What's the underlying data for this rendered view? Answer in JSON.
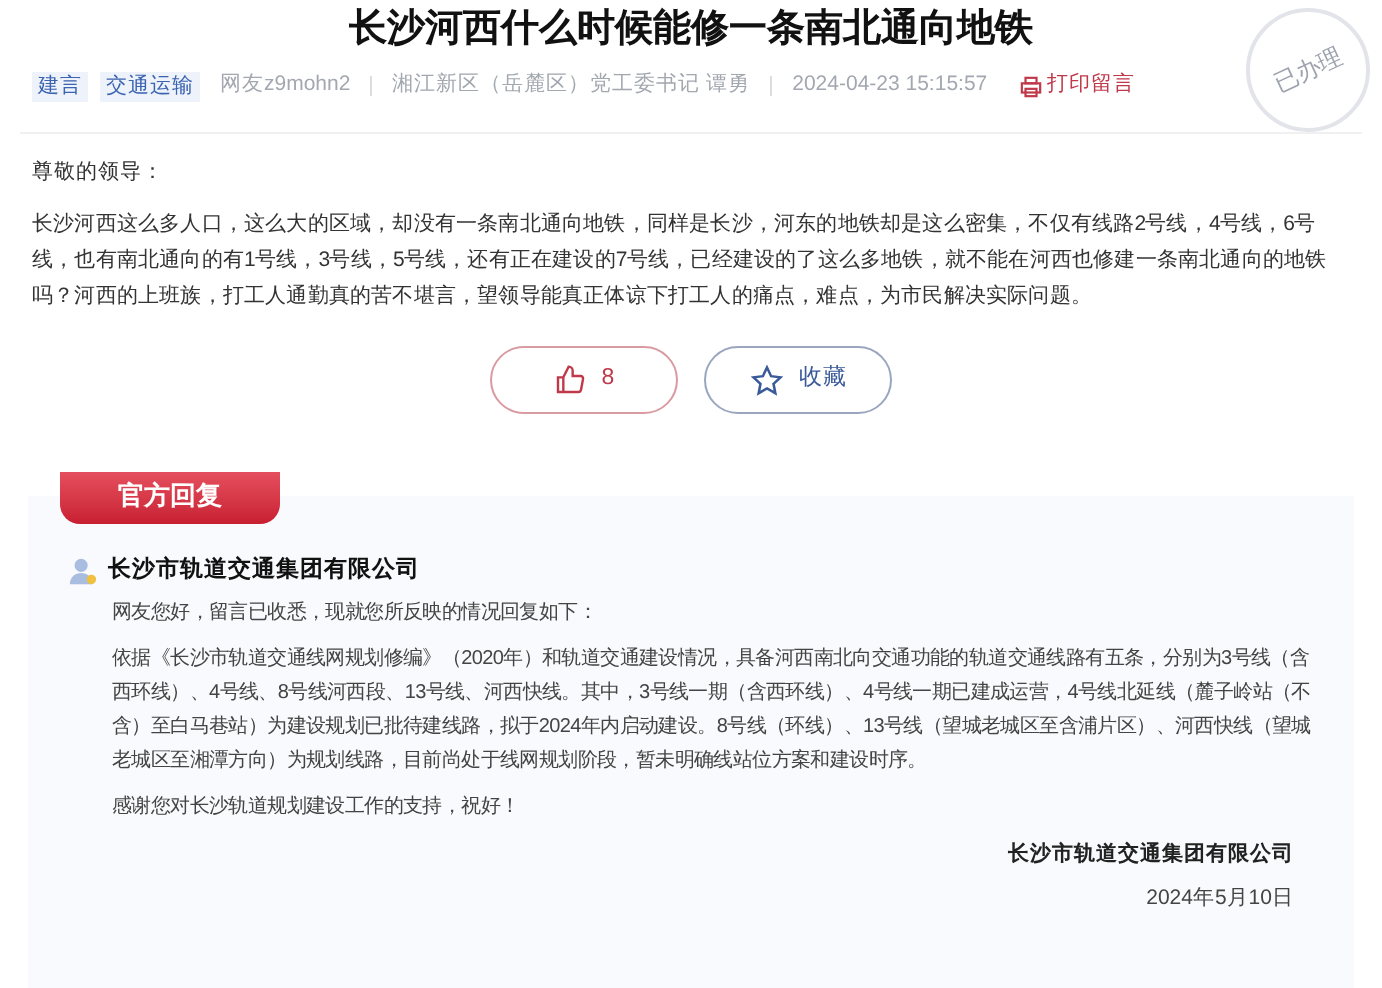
{
  "title": "长沙河西什么时候能修一条南北通向地铁",
  "tags": [
    "建言",
    "交通运输"
  ],
  "meta": [
    "网友z9mohn2",
    "湘江新区（岳麓区）党工委书记 谭勇",
    "2024-04-23 15:15:57"
  ],
  "print_link": "打印留言",
  "stamp": "已办理",
  "message": {
    "greeting": "尊敬的领导：",
    "body": "长沙河西这么多人口，这么大的区域，却没有一条南北通向地铁，同样是长沙，河东的地铁却是这么密集，不仅有线路2号线，4号线，6号线，也有南北通向的有1号线，3号线，5号线，还有正在建设的7号线，已经建设的了这么多地铁，就不能在河西也修建一条南北通向的地铁吗？河西的上班族，打工人通勤真的苦不堪言，望领导能真正体谅下打工人的痛点，难点，为市民解决实际问题。"
  },
  "actions": [
    {
      "kind": "like",
      "text": "8"
    },
    {
      "kind": "favorite",
      "text": "收藏"
    }
  ],
  "reply": {
    "ribbon": "官方回复",
    "org": "长沙市轨道交通集团有限公司",
    "paragraphs": [
      "网友您好，留言已收悉，现就您所反映的情况回复如下：",
      "依据《长沙市轨道交通线网规划修编》（2020年）和轨道交通建设情况，具备河西南北向交通功能的轨道交通线路有五条，分别为3号线（含西环线）、4号线、8号线河西段、13号线、河西快线。其中，3号线一期（含西环线）、4号线一期已建成运营，4号线北延线（麓子岭站（不含）至白马巷站）为建设规划已批待建线路，拟于2024年内启动建设。8号线（环线）、13号线（望城老城区至含浦片区）、河西快线（望城老城区至湘潭方向）为规划线路，目前尚处于线网规划阶段，暂未明确线站位方案和建设时序。",
      "感谢您对长沙轨道规划建设工作的支持，祝好！"
    ],
    "signature": "长沙市轨道交通集团有限公司",
    "date": "2024年5月10日"
  }
}
